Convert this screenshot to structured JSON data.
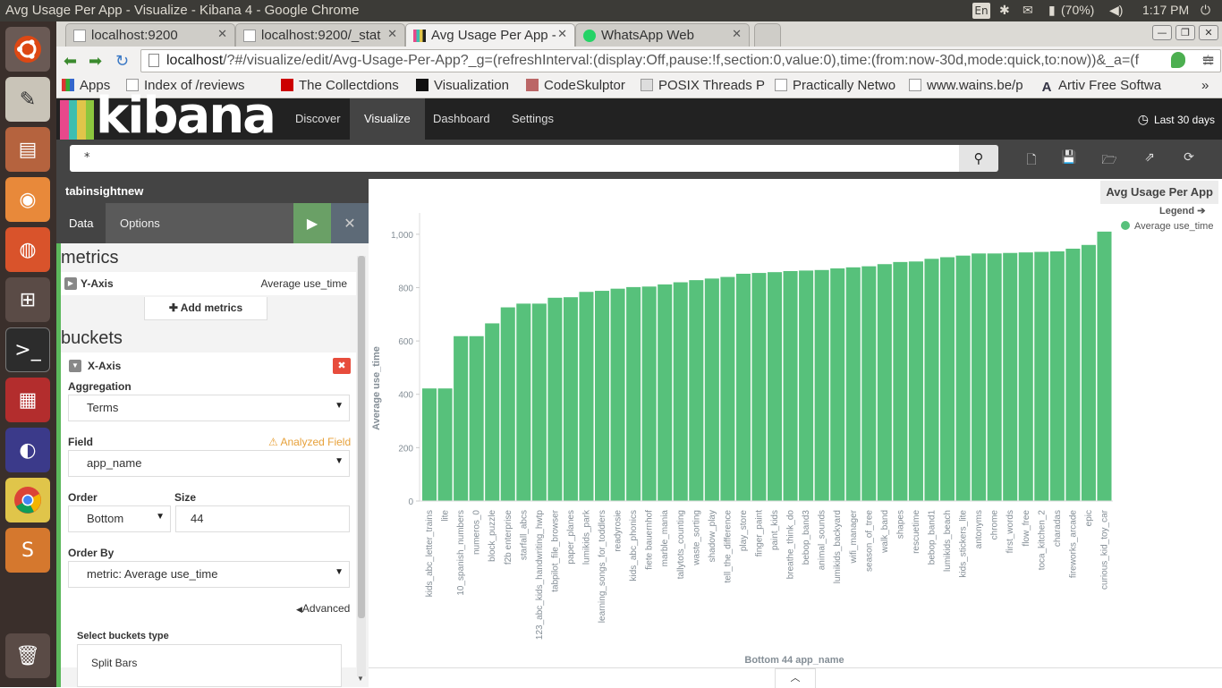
{
  "os": {
    "window_title": "Avg Usage Per App - Visualize - Kibana 4 - Google Chrome",
    "keyboard": "En",
    "battery": "(70%)",
    "clock": "1:17 PM"
  },
  "browser": {
    "tabs": [
      {
        "label": "localhost:9200"
      },
      {
        "label": "localhost:9200/_stat"
      },
      {
        "label": "Avg Usage Per App -"
      },
      {
        "label": "WhatsApp Web"
      }
    ],
    "url_host": "localhost",
    "url_rest": "/?#/visualize/edit/Avg-Usage-Per-App?_g=(refreshInterval:(display:Off,pause:!f,section:0,value:0),time:(from:now-30d,mode:quick,to:now))&_a=(f",
    "bookmarks": [
      "Apps",
      "Index of /reviews",
      "The Collectdions",
      "Visualization",
      "CodeSkulptor",
      "POSIX Threads Pr",
      "Practically Netwo",
      "www.wains.be/p",
      "Artiv Free Softwa"
    ],
    "bookmarks_more": "»"
  },
  "kibana": {
    "logo_text": "kibana",
    "nav": [
      "Discover",
      "Visualize",
      "Dashboard",
      "Settings"
    ],
    "time_range": "Last 30 days",
    "query": "*",
    "index_name": "tabinsightnew",
    "panel_tabs": [
      "Data",
      "Options"
    ],
    "metrics_title": "metrics",
    "y_axis_label": "Y-Axis",
    "y_axis_value": "Average use_time",
    "add_metrics": "Add metrics",
    "buckets_title": "buckets",
    "x_axis_label": "X-Axis",
    "aggregation_label": "Aggregation",
    "aggregation_value": "Terms",
    "field_label": "Field",
    "analyzed_field": "Analyzed Field",
    "field_value": "app_name",
    "order_label": "Order",
    "order_value": "Bottom",
    "size_label": "Size",
    "size_value": "44",
    "order_by_label": "Order By",
    "order_by_value": "metric: Average use_time",
    "advanced": "Advanced",
    "select_buckets_type": "Select buckets type",
    "split_bars": "Split Bars",
    "vis_title": "Avg Usage Per App",
    "legend_label": "Legend",
    "legend_item": "Average use_time"
  },
  "chart_data": {
    "type": "bar",
    "xlabel": "Bottom 44 app_name",
    "ylabel": "Average use_time",
    "ylim": [
      0,
      1080
    ],
    "yticks": [
      0,
      200,
      400,
      600,
      800,
      1000
    ],
    "ytick_labels": [
      "0",
      "200",
      "400",
      "600",
      "800",
      "1,000"
    ],
    "grid": false,
    "legend_position": "top-right",
    "series": [
      {
        "name": "Average use_time",
        "color": "#57c17b"
      }
    ],
    "categories": [
      "kids_abc_letter_trains",
      "lite",
      "10_spanish_numbers",
      "numeros_0",
      "block_puzzle",
      "f2b enterprise",
      "starfall_abcs",
      "123_abc_kids_handwriting_hwtp",
      "tabpilot_file_browser",
      "paper_planes",
      "lumikids_park",
      "learning_songs_for_toddlers",
      "readyrosie",
      "kids_abc_phonics",
      "fiete bauernhof",
      "marble_mania",
      "tallytots_counting",
      "waste_sorting",
      "shadow_play",
      "tell_the_difference",
      "play_store",
      "finger_paint",
      "paint_kids",
      "breathe_think_do",
      "bebop_band3",
      "animal_sounds",
      "lumikids_backyard",
      "wifi_manager",
      "season_of_tree",
      "walk_band",
      "shapes",
      "rescuetime",
      "bebop_band1",
      "lumikids_beach",
      "kids_stickers_lite",
      "antonyms",
      "chrome",
      "first_words",
      "flow_free",
      "toca_kitchen_2",
      "charadas",
      "fireworks_arcade",
      "epic",
      "curious_kid_toy_car"
    ],
    "values": [
      422,
      422,
      618,
      618,
      666,
      726,
      740,
      740,
      762,
      764,
      784,
      788,
      796,
      802,
      804,
      812,
      820,
      828,
      834,
      840,
      852,
      855,
      858,
      862,
      864,
      866,
      872,
      876,
      880,
      888,
      896,
      898,
      908,
      914,
      920,
      928,
      928,
      930,
      932,
      934,
      936,
      946,
      960,
      1010
    ]
  }
}
